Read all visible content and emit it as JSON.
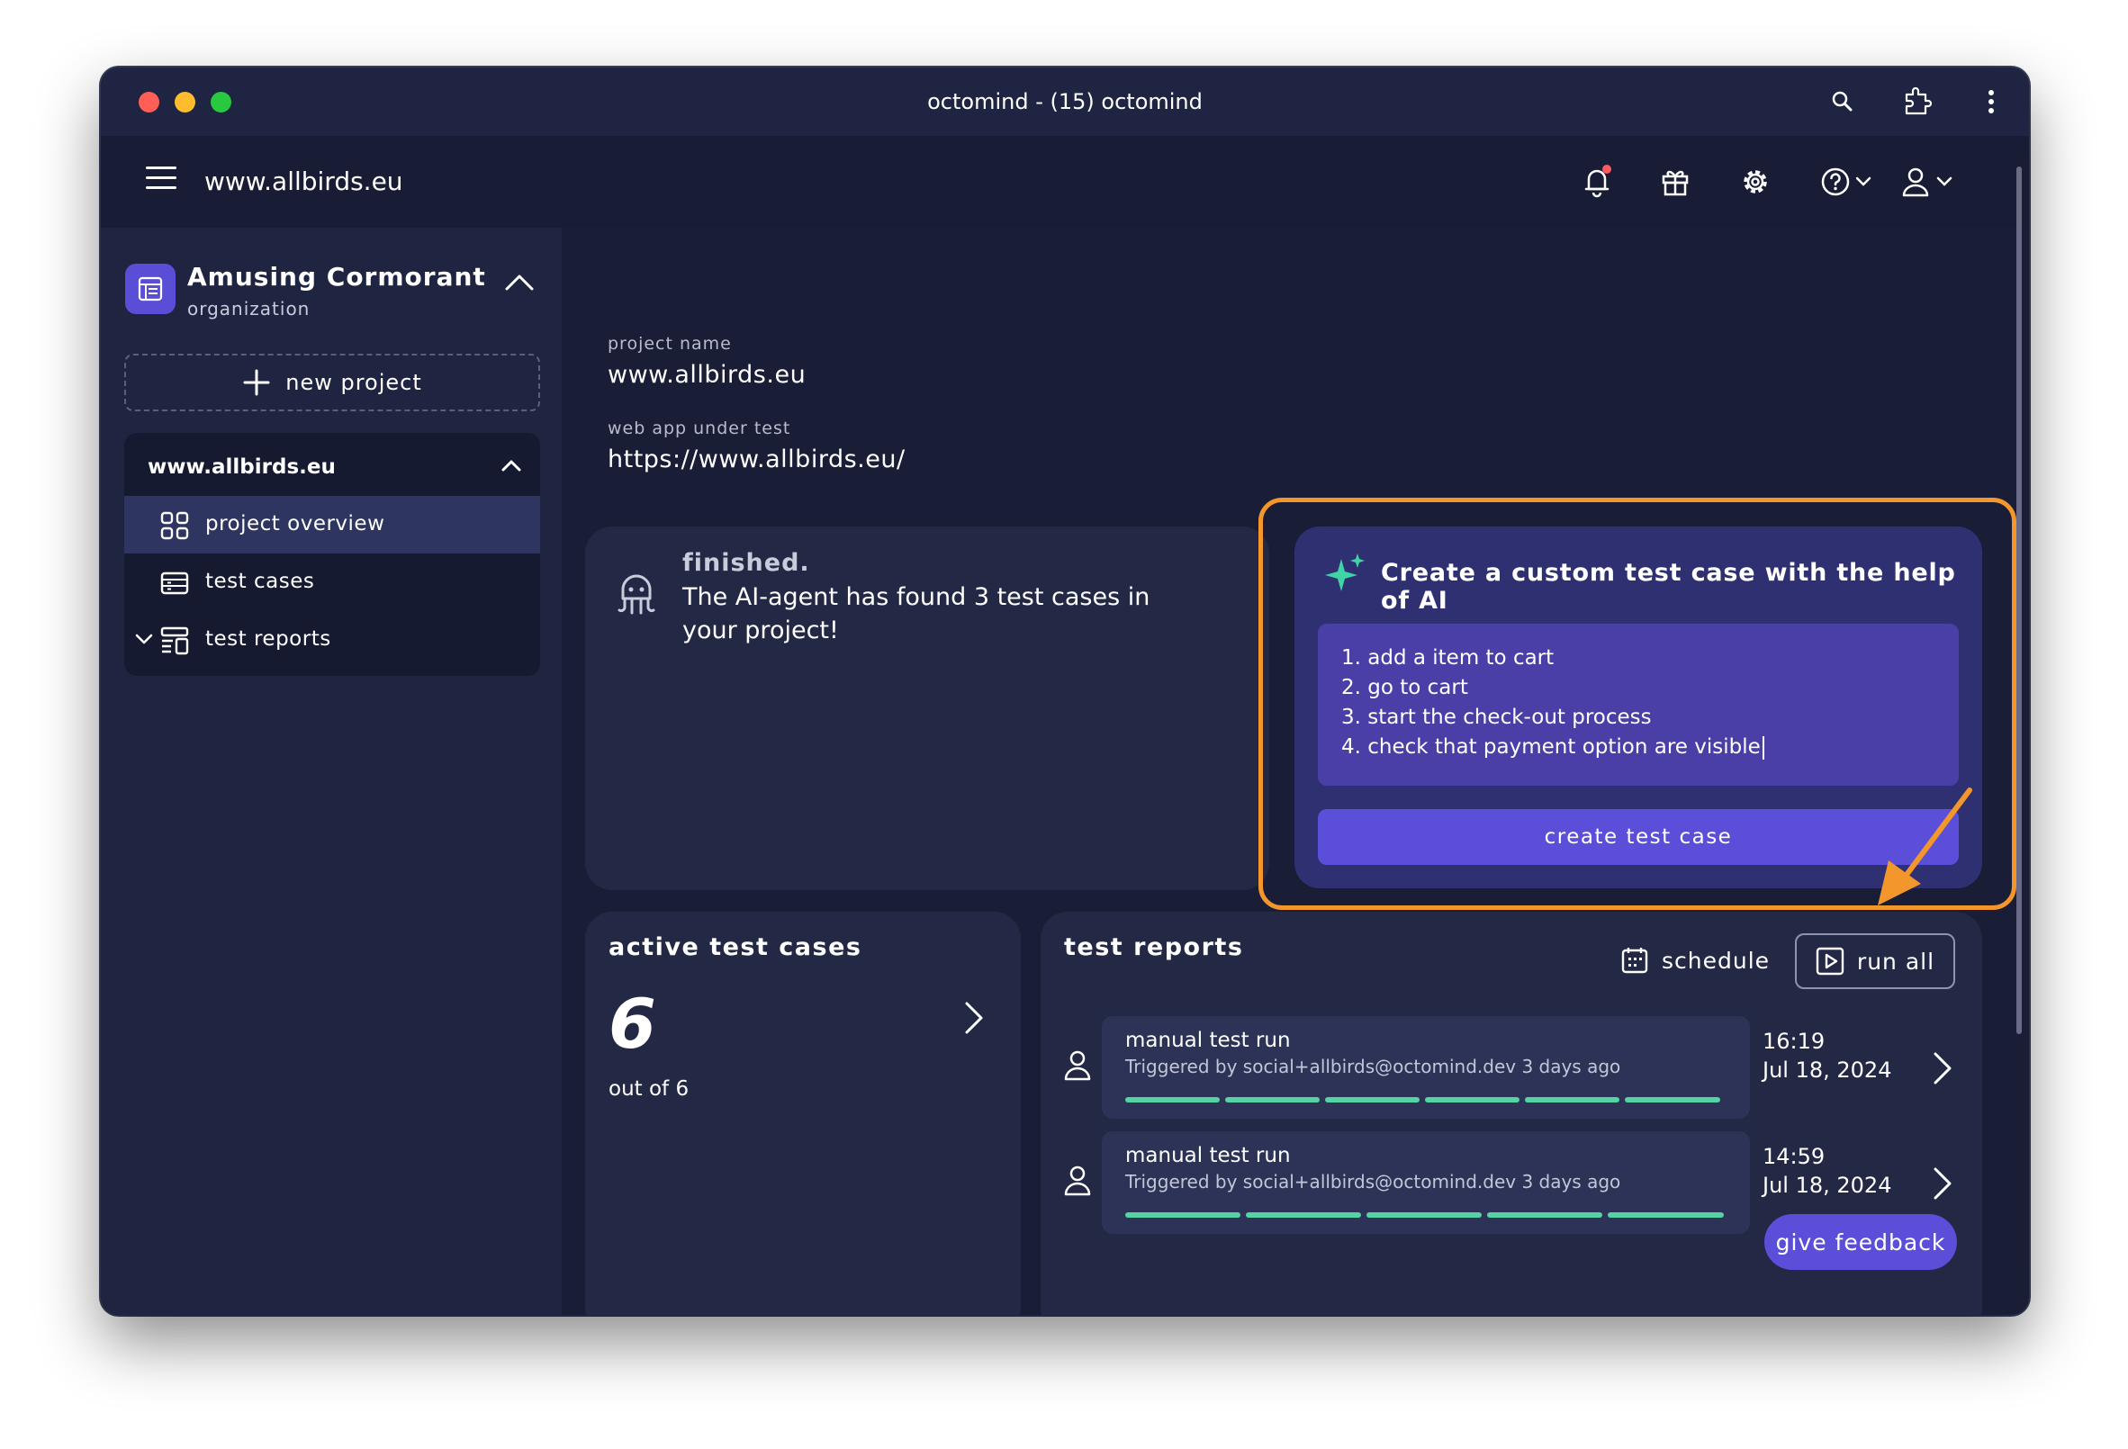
{
  "window": {
    "title": "octomind - (15) octomind"
  },
  "header": {
    "site": "www.allbirds.eu"
  },
  "sidebar": {
    "org_name": "Amusing Cormorant",
    "org_type": "organization",
    "new_project": "new project",
    "project": "www.allbirds.eu",
    "items": [
      {
        "label": "project overview",
        "icon": "grid-icon",
        "active": true
      },
      {
        "label": "test cases",
        "icon": "list-icon",
        "active": false
      },
      {
        "label": "test reports",
        "icon": "report-icon",
        "active": false
      }
    ]
  },
  "project": {
    "name_label": "project name",
    "name": "www.allbirds.eu",
    "url_label": "web app under test",
    "url": "https://www.allbirds.eu/"
  },
  "status": {
    "title": "finished.",
    "text": "The AI-agent has found 3 test cases in your project!"
  },
  "ai": {
    "title": "Create a custom test case with the help of AI",
    "lines": [
      "1. add a item to cart",
      "2. go to cart",
      "3. start the check-out process",
      "4. check that payment option are visible"
    ],
    "button": "create test case"
  },
  "active_tests": {
    "title": "active test cases",
    "count": "6",
    "sub": "out of 6"
  },
  "reports": {
    "title": "test reports",
    "schedule": "schedule",
    "run_all": "run all",
    "runs": [
      {
        "title": "manual test run",
        "sub": "Triggered by social+allbirds@octomind.dev 3 days ago",
        "time": "16:19",
        "date": "Jul 18, 2024"
      },
      {
        "title": "manual test run",
        "sub": "Triggered by social+allbirds@octomind.dev 3 days ago",
        "time": "14:59",
        "date": "Jul 18, 2024"
      }
    ]
  },
  "feedback": "give feedback",
  "colors": {
    "accent": "#5b4fd9",
    "highlight": "#f3962b",
    "pass": "#56d3a2"
  }
}
